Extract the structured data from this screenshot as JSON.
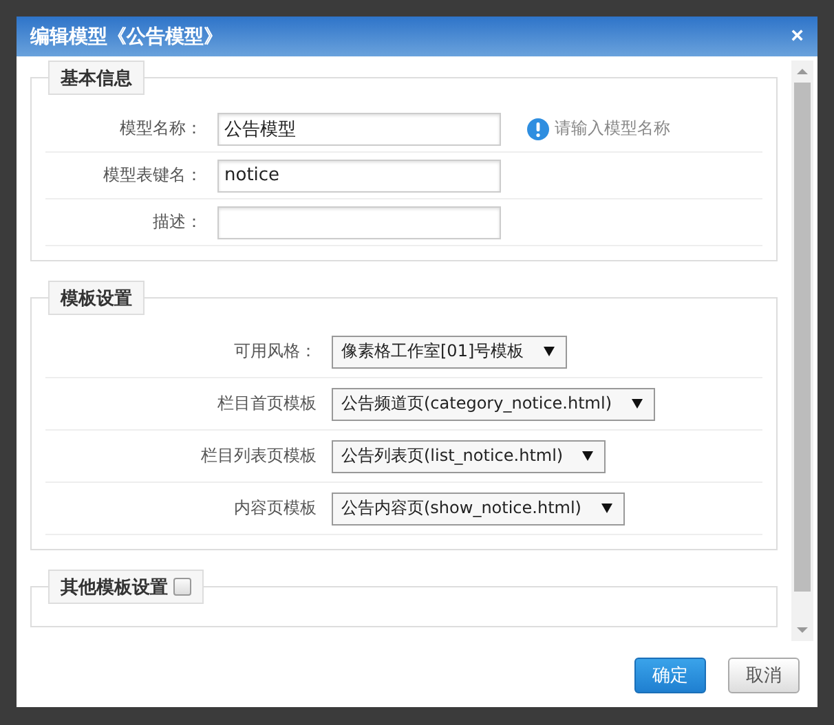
{
  "dialog": {
    "title": "编辑模型《公告模型》",
    "close": "×"
  },
  "sections": [
    {
      "legend": "基本信息",
      "rows": [
        {
          "kind": "input",
          "label": "模型名称：",
          "value": "公告模型",
          "hint": "请输入模型名称"
        },
        {
          "kind": "input",
          "label": "模型表键名：",
          "value": "notice"
        },
        {
          "kind": "input",
          "label": "描述："
        }
      ]
    },
    {
      "legend": "模板设置",
      "rows": [
        {
          "kind": "select",
          "label": "可用风格：",
          "value": "像素格工作室[01]号模板"
        },
        {
          "kind": "select",
          "label": "栏目首页模板",
          "value": "公告频道页(category_notice.html)"
        },
        {
          "kind": "select",
          "label": "栏目列表页模板",
          "value": "公告列表页(list_notice.html)"
        },
        {
          "kind": "select",
          "label": "内容页模板",
          "value": "公告内容页(show_notice.html)"
        }
      ]
    },
    {
      "legend": "其他模板设置",
      "checked": false
    }
  ],
  "buttons": [
    {
      "kind": "primary",
      "label": "确定"
    },
    {
      "kind": "secondary",
      "label": "取消"
    }
  ]
}
